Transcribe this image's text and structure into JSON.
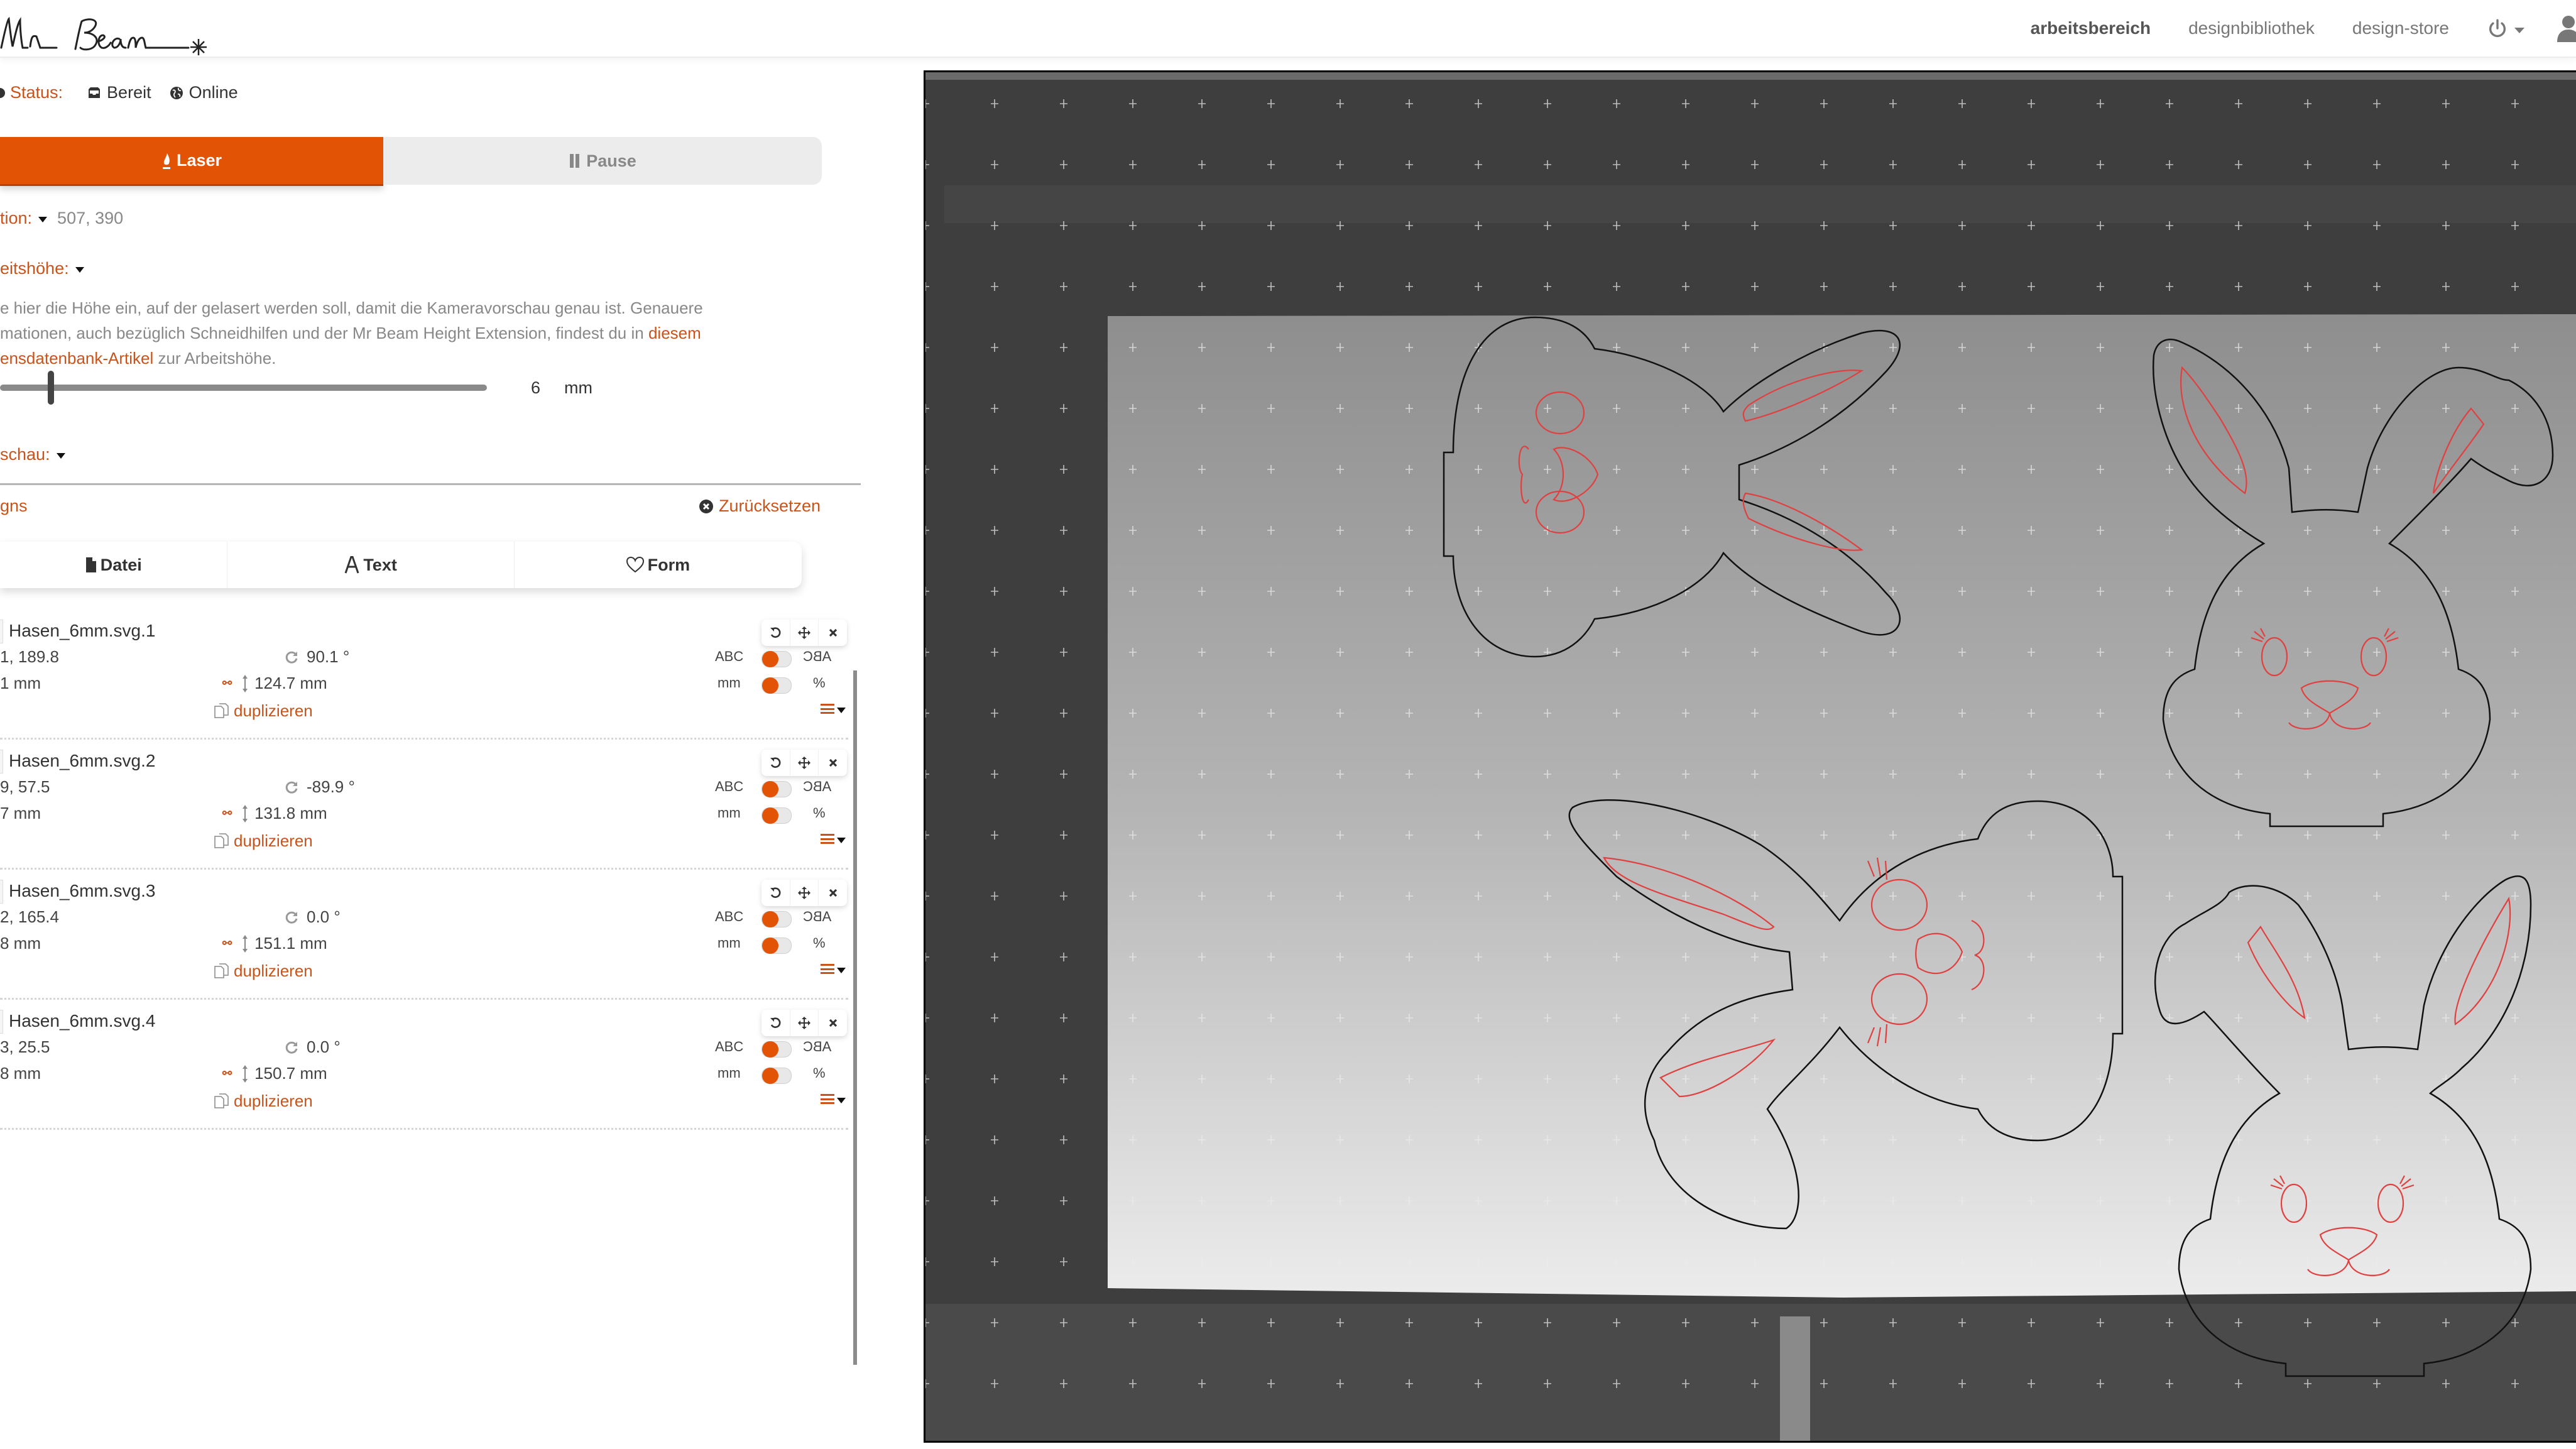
{
  "header": {
    "logo_text": "Mr Beam",
    "nav": [
      {
        "label": "arbeitsbereich",
        "active": true
      },
      {
        "label": "designbibliothek",
        "active": false
      },
      {
        "label": "design-store",
        "active": false
      }
    ]
  },
  "status": {
    "label": "Status:",
    "state": "Bereit",
    "connection": "Online"
  },
  "laser_controls": {
    "laser_label": "Laser",
    "pause_label": "Pause"
  },
  "position": {
    "label": "tion:",
    "value": "507, 390"
  },
  "work_height": {
    "label": "eitshöhe:",
    "help_part1": "e hier die Höhe ein, auf der gelasert werden soll, damit die Kameravorschau genau ist. Genauere mationen, auch bezüglich Schneidhilfen und der Mr Beam Height Extension, findest du in ",
    "help_link": "diesem ensdatenbank-Artikel",
    "help_part2": " zur Arbeitshöhe.",
    "slider_value": "6",
    "unit": "mm"
  },
  "preview": {
    "label": "schau:"
  },
  "designs": {
    "label": "gns",
    "reset_label": "Zurücksetzen",
    "add_tabs": [
      {
        "label": "Datei",
        "icon": "file-icon"
      },
      {
        "label": "Text",
        "icon": "font-icon"
      },
      {
        "label": "Form",
        "icon": "heart-icon"
      }
    ],
    "items": [
      {
        "name": "Hasen_6mm.svg.1",
        "xy": "1, 189.8",
        "width": "1 mm",
        "rotation": "90.1 °",
        "height": "124.7 mm",
        "duplicate": "duplizieren",
        "mirror_left": "ABC",
        "mirror_right": "ABC",
        "unit_left": "mm",
        "unit_right": "%"
      },
      {
        "name": "Hasen_6mm.svg.2",
        "xy": "9, 57.5",
        "width": "7 mm",
        "rotation": "-89.9 °",
        "height": "131.8 mm",
        "duplicate": "duplizieren",
        "mirror_left": "ABC",
        "mirror_right": "ABC",
        "unit_left": "mm",
        "unit_right": "%"
      },
      {
        "name": "Hasen_6mm.svg.3",
        "xy": "2, 165.4",
        "width": "8 mm",
        "rotation": "0.0 °",
        "height": "151.1 mm",
        "duplicate": "duplizieren",
        "mirror_left": "ABC",
        "mirror_right": "ABC",
        "unit_left": "mm",
        "unit_right": "%"
      },
      {
        "name": "Hasen_6mm.svg.4",
        "xy": "3, 25.5",
        "width": "8 mm",
        "rotation": "0.0 °",
        "height": "150.7 mm",
        "duplicate": "duplizieren",
        "mirror_left": "ABC",
        "mirror_right": "ABC",
        "unit_left": "mm",
        "unit_right": "%"
      }
    ]
  },
  "colors": {
    "accent": "#e25306",
    "link": "#c8541b",
    "engrave_line": "#e04040",
    "cut_line": "#111111"
  }
}
